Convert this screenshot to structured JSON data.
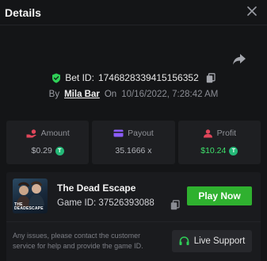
{
  "header": {
    "title": "Details",
    "close_icon": "close-icon"
  },
  "bet": {
    "label": "Bet ID:",
    "id": "1746828339415156352",
    "by_label": "By",
    "user": "Mila Bar",
    "on_label": "On",
    "datetime": "10/16/2022, 7:28:42 AM",
    "verified_color": "#2fcf57"
  },
  "stats": {
    "amount": {
      "label": "Amount",
      "value": "$0.29",
      "icon": "money-hand-icon",
      "color": "#e0465a"
    },
    "payout": {
      "label": "Payout",
      "value": "35.1666 x",
      "icon": "card-icon",
      "color": "#8b5cf6"
    },
    "profit": {
      "label": "Profit",
      "value": "$10.24",
      "icon": "user-profit-icon",
      "color": "#e0465a",
      "value_color": "#3ee06b"
    }
  },
  "coin_symbol": "T",
  "game": {
    "name": "The Dead Escape",
    "id_label": "Game ID:",
    "id": "37526393088",
    "thumb_text": "THE DEADESCAPE",
    "play_label": "Play Now"
  },
  "footer": {
    "info": "Any issues, please contact the customer service for help and provide the game ID.",
    "support_label": "Live Support"
  }
}
